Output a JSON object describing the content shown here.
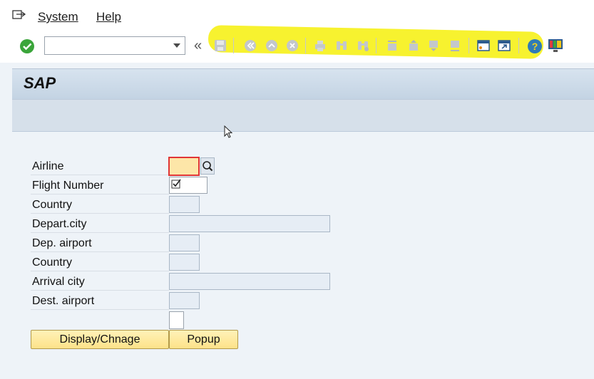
{
  "menu": {
    "items": [
      {
        "label": "System",
        "underline_index": 0
      },
      {
        "label": "Help",
        "underline_index": 0
      }
    ]
  },
  "toolbar": {
    "command_field": {
      "value": "",
      "placeholder": ""
    },
    "collapse_symbol": "«",
    "icons": [
      "enter-icon",
      "save-icon",
      "back-icon",
      "exit-icon",
      "cancel-icon",
      "print-icon",
      "find-icon",
      "find-next-icon",
      "first-page-icon",
      "previous-page-icon",
      "next-page-icon",
      "last-page-icon",
      "new-session-icon",
      "shortcut-icon",
      "help-icon",
      "customize-layout-icon"
    ],
    "colors": {
      "enter_green": "#3aa53a",
      "highlight": "#f6f00a"
    }
  },
  "title": {
    "text": "SAP"
  },
  "form": {
    "fields": [
      {
        "label": "Airline",
        "type": "required"
      },
      {
        "label": "Flight Number",
        "type": "checkbox"
      },
      {
        "label": "Country",
        "type": "readonly"
      },
      {
        "label": "Depart.city",
        "type": "readonly"
      },
      {
        "label": "Dep. airport",
        "type": "readonly"
      },
      {
        "label": "Country",
        "type": "readonly"
      },
      {
        "label": "Arrival city",
        "type": "readonly"
      },
      {
        "label": "Dest. airport",
        "type": "readonly"
      }
    ],
    "flight_number_checked": true
  },
  "buttons": {
    "display_change": "Display/Chnage",
    "popup": "Popup"
  }
}
